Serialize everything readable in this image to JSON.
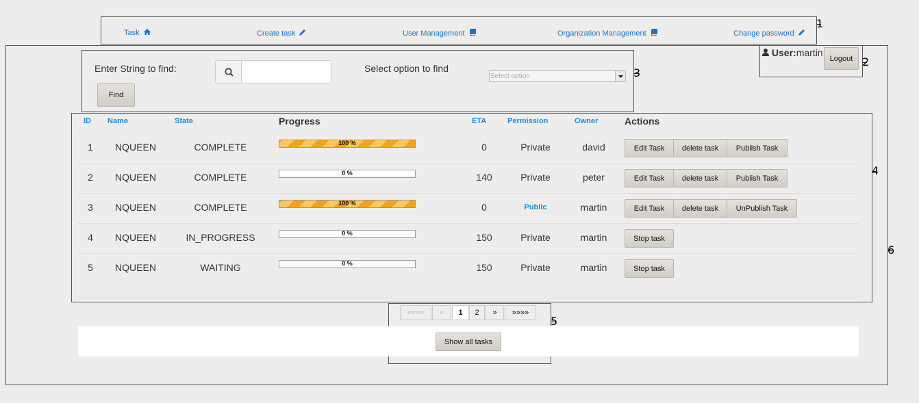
{
  "nav": {
    "items": [
      {
        "label": "Task",
        "icon": "home-icon"
      },
      {
        "label": "Create task",
        "icon": "pencil-icon"
      },
      {
        "label": "User Management",
        "icon": "book-icon"
      },
      {
        "label": "Organization Management",
        "icon": "book-icon"
      },
      {
        "label": "Change password",
        "icon": "pencil-icon"
      }
    ]
  },
  "user": {
    "label": "User:",
    "name": "martin",
    "logout_label": "Logout"
  },
  "search": {
    "prompt": "Enter String to find:",
    "value": "",
    "option_prompt": "Select option to find",
    "select_placeholder": "Select option",
    "find_label": "Find"
  },
  "table": {
    "headers": {
      "id": "ID",
      "name": "Name",
      "state": "State",
      "progress": "Progress",
      "eta": "ETA",
      "permission": "Permission",
      "owner": "Owner",
      "actions": "Actions"
    },
    "rows": [
      {
        "id": "1",
        "name": "NQUEEN",
        "state": "COMPLETE",
        "progress": 100,
        "progress_label": "100 %",
        "eta": "0",
        "permission": "Private",
        "owner": "david",
        "actions": [
          "Edit Task",
          "delete task",
          "Publish Task"
        ]
      },
      {
        "id": "2",
        "name": "NQUEEN",
        "state": "COMPLETE",
        "progress": 0,
        "progress_label": "0 %",
        "eta": "140",
        "permission": "Private",
        "owner": "peter",
        "actions": [
          "Edit Task",
          "delete task",
          "Publish Task"
        ]
      },
      {
        "id": "3",
        "name": "NQUEEN",
        "state": "COMPLETE",
        "progress": 100,
        "progress_label": "100 %",
        "eta": "0",
        "permission": "Public",
        "owner": "martin",
        "actions": [
          "Edit Task",
          "delete task",
          "UnPublish Task"
        ]
      },
      {
        "id": "4",
        "name": "NQUEEN",
        "state": "IN_PROGRESS",
        "progress": 0,
        "progress_label": "0 %",
        "eta": "150",
        "permission": "Private",
        "owner": "martin",
        "actions": [
          "Stop task"
        ]
      },
      {
        "id": "5",
        "name": "NQUEEN",
        "state": "WAITING",
        "progress": 0,
        "progress_label": "0 %",
        "eta": "150",
        "permission": "Private",
        "owner": "martin",
        "actions": [
          "Stop task"
        ]
      }
    ]
  },
  "pagination": {
    "first": "««««",
    "prev": "«",
    "pages": [
      "1",
      "2"
    ],
    "current": "1",
    "next": "»",
    "last": "»»»»"
  },
  "show_all_label": "Show all tasks",
  "callouts": [
    "1",
    "2",
    "3",
    "4",
    "5",
    "6"
  ],
  "colors": {
    "link": "#1a73c9",
    "header_link": "#1a8fd8",
    "progress": "#f2a21b"
  }
}
